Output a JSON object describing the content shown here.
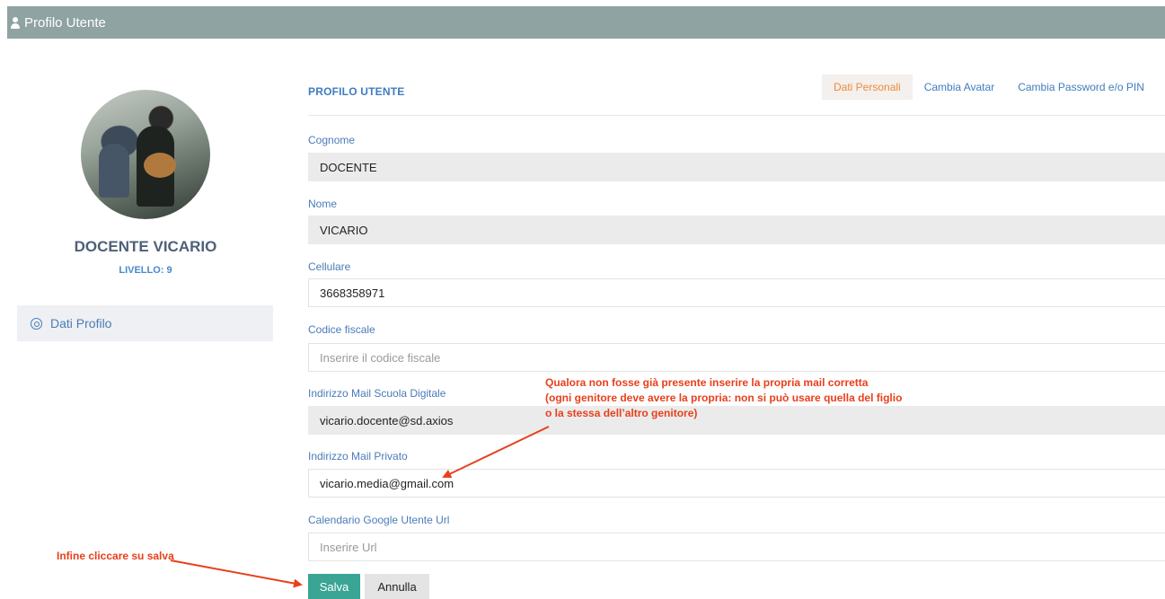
{
  "header": {
    "title": "Profilo Utente",
    "icon": "user-icon"
  },
  "profile": {
    "name": "DOCENTE VICARIO",
    "level": "LIVELLO: 9"
  },
  "sidebar": {
    "items": [
      {
        "label": "Dati Profilo",
        "icon": "gear-icon"
      }
    ]
  },
  "panel": {
    "title": "PROFILO UTENTE",
    "tabs": [
      {
        "label": "Dati Personali",
        "active": true
      },
      {
        "label": "Cambia Avatar",
        "active": false
      },
      {
        "label": "Cambia Password e/o PIN",
        "active": false
      }
    ]
  },
  "form": {
    "cognome": {
      "label": "Cognome",
      "value": "DOCENTE"
    },
    "nome": {
      "label": "Nome",
      "value": "VICARIO"
    },
    "cellulare": {
      "label": "Cellulare",
      "value": "3668358971"
    },
    "codice_fiscale": {
      "label": "Codice fiscale",
      "value": "",
      "placeholder": "Inserire il codice fiscale"
    },
    "mail_scuola": {
      "label": "Indirizzo Mail Scuola Digitale",
      "value": "vicario.docente@sd.axios"
    },
    "mail_privato": {
      "label": "Indirizzo Mail Privato",
      "value": "vicario.media@gmail.com"
    },
    "calendario": {
      "label": "Calendario Google Utente Url",
      "value": "",
      "placeholder": "Inserire Url"
    }
  },
  "buttons": {
    "save": "Salva",
    "cancel": "Annulla"
  },
  "annotations": {
    "mail_note": [
      "Qualora non fosse già presente inserire la propria mail corretta",
      "(ogni genitore deve avere la propria: non si può usare quella del figlio",
      "o la stessa dell’altro genitore)"
    ],
    "save_note": "Infine cliccare su salva"
  },
  "colors": {
    "header_bg": "#8ea3a2",
    "accent_blue": "#4a7bb8",
    "active_tab": "#f08a3a",
    "save_button": "#3aa594",
    "annotation_red": "#e8401c"
  }
}
